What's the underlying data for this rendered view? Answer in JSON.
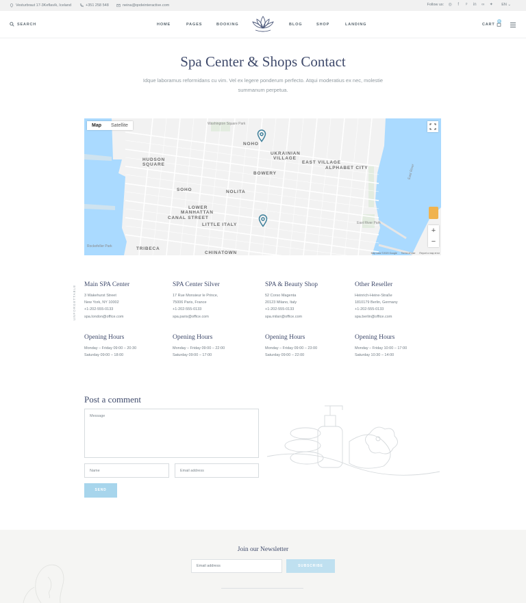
{
  "topbar": {
    "address": "Vesturbraut 17-3Keflavík, Iceland",
    "phone": "+351 258 548",
    "email": "neina@qodeinteractive.com",
    "follow_label": "Follow us:",
    "language": "EN"
  },
  "header": {
    "search_label": "SEARCH",
    "nav": [
      "HOME",
      "PAGES",
      "BOOKING",
      "BLOG",
      "SHOP",
      "LANDING"
    ],
    "cart_label": "CART",
    "cart_count": "0"
  },
  "hero": {
    "title": "Spa Center & Shops Contact",
    "subtitle": "Idque laboramus reformidans cu vim. Vel ex legere ponderum perfecto. Atqui moderatius ex nec, molestie summanum perpetua."
  },
  "map": {
    "toggle_map": "Map",
    "toggle_satellite": "Satellite",
    "labels": {
      "noho": "NOHO",
      "ukrainian": "UKRAINIAN",
      "village": "VILLAGE",
      "east_village": "EAST VILLAGE",
      "alphabet_city": "ALPHABET CITY",
      "hudson": "HUDSON",
      "square": "SQUARE",
      "bowery": "BOWERY",
      "soho": "SOHO",
      "nolita": "NOLITA",
      "lower": "LOWER",
      "manhattan": "MANHATTAN",
      "canal_street": "CANAL STREET",
      "little_italy": "LITTLE ITALY",
      "tribeca": "TRIBECA",
      "chinatown": "CHINATOWN",
      "washington_square": "Washington Square Park",
      "east_river": "East River",
      "east_river_park": "East River Park",
      "rockefeller": "Rockefeller Park"
    },
    "footer": [
      "Map data ©2020 Google",
      "Terms of Use",
      "Report a map error"
    ],
    "zoom_in": "+",
    "zoom_out": "−"
  },
  "locations_side_label": "UNFORGETTABLE",
  "locations": [
    {
      "name": "Main SPA Center",
      "lines": [
        "3 Wakehurst Street",
        "New York, NY 10002",
        "+1-202-555-0133",
        "spa.london@office.com"
      ],
      "hours_title": "Opening Hours",
      "hours": [
        "Monday – Friday 09:00 – 20:30",
        "Saturday 09:00 – 18:00"
      ]
    },
    {
      "name": "SPA Center Silver",
      "lines": [
        "17 Rue Monsieur le Prince,",
        "75006 Paris, France",
        "+1-202-555-0133",
        "spa.paris@office.com"
      ],
      "hours_title": "Opening Hours",
      "hours": [
        "Monday – Friday 09:00 – 22:00",
        "Saturday 09:00 – 17:00"
      ]
    },
    {
      "name": "SPA & Beauty Shop",
      "lines": [
        "52 Corso Magenta",
        "20123 Milano, Italy",
        "+1-202-555-0133",
        "spa.milan@office.com"
      ],
      "hours_title": "Opening Hours",
      "hours": [
        "Monday – Friday 09:00 – 23:00",
        "Saturday 09:00 – 22:00"
      ]
    },
    {
      "name": "Other Reseller",
      "lines": [
        "Heinrich-Heine-Straße",
        "1810179 Berlin, Germany",
        "+1-202-555-0133",
        "spa.berlin@office.com"
      ],
      "hours_title": "Opening Hours",
      "hours": [
        "Monday – Friday 10:00 – 17:00",
        "Saturday 10:30 – 14:00"
      ]
    }
  ],
  "comment": {
    "title": "Post a comment",
    "message_placeholder": "Message",
    "name_placeholder": "Name",
    "email_placeholder": "Email address",
    "send_label": "SEND"
  },
  "newsletter": {
    "title": "Join our Newsletter",
    "email_placeholder": "Email address",
    "button_label": "SUBSCRIBE"
  },
  "colors": {
    "accent": "#a7d5ec",
    "heading": "#3f4a6b",
    "water": "#aadaff"
  }
}
